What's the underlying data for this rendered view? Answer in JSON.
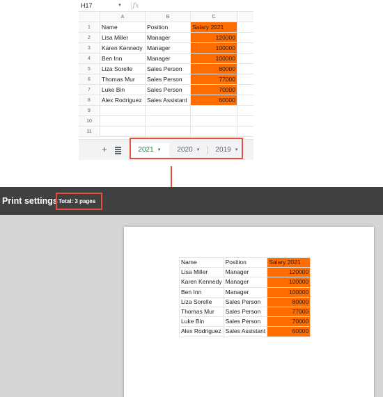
{
  "spreadsheet": {
    "name_box": "H17",
    "fx_label": "fx",
    "column_headers": [
      "A",
      "B",
      "C"
    ],
    "row_numbers": [
      "1",
      "2",
      "3",
      "4",
      "5",
      "6",
      "7",
      "8",
      "9",
      "10",
      "11"
    ],
    "header_row": [
      "Name",
      "Position",
      "Salary 2021"
    ],
    "rows": [
      [
        "Lisa Miller",
        "Manager",
        "120000"
      ],
      [
        "Karen Kennedy",
        "Manager",
        "100000"
      ],
      [
        "Ben Inn",
        "Manager",
        "100000"
      ],
      [
        "Liza Sorelle",
        "Sales Person",
        "80000"
      ],
      [
        "Thomas Mur",
        "Sales Person",
        "77000"
      ],
      [
        "Luke Bin",
        "Sales Person",
        "70000"
      ],
      [
        "Alex Rodriguez",
        "Sales Assistant",
        "60000"
      ]
    ],
    "highlight_color": "#ff6d01",
    "add_sheet_symbol": "+",
    "sheet_tabs": [
      {
        "label": "2021",
        "active": true
      },
      {
        "label": "2020",
        "active": false
      },
      {
        "label": "2019",
        "active": false
      }
    ],
    "active_tab_color": "#188038"
  },
  "print_settings": {
    "title": "Print settings",
    "total_label": "Total: 3 pages"
  },
  "annotation_color": "#e74c3c"
}
